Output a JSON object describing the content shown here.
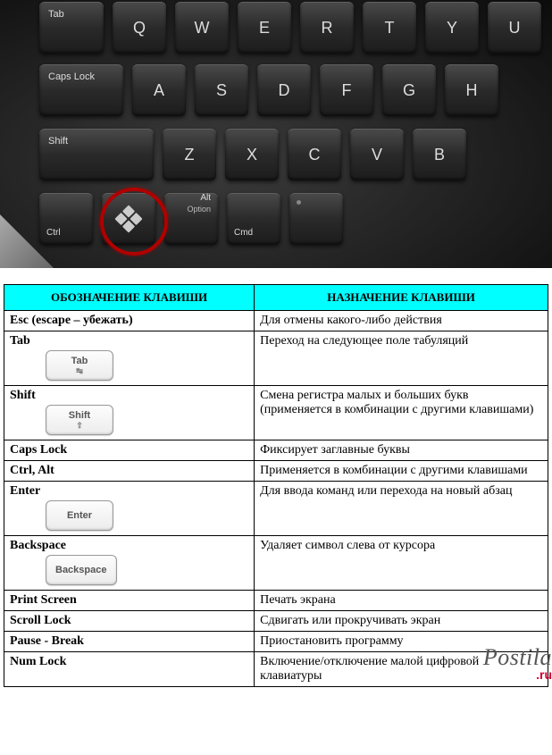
{
  "keyboard": {
    "row0": [
      "Tab",
      "Q",
      "W",
      "E",
      "R",
      "T",
      "Y",
      "U"
    ],
    "row1": [
      "Caps Lock",
      "A",
      "S",
      "D",
      "F",
      "G",
      "H"
    ],
    "row2": [
      "Shift",
      "Z",
      "X",
      "C",
      "V",
      "B"
    ],
    "row3": {
      "ctrl": "Ctrl",
      "win": "windows-key",
      "alt": "Alt",
      "option": "Option",
      "cmd": "Cmd",
      "space": " "
    },
    "highlight": "windows-key"
  },
  "table": {
    "header_key": "ОБОЗНАЧЕНИЕ КЛАВИШИ",
    "header_desc": "НАЗНАЧЕНИЕ КЛАВИШИ",
    "rows": [
      {
        "key": "Esc (escape – убежать)",
        "desc": "Для отмены какого-либо действия",
        "cap": null
      },
      {
        "key": "Tab",
        "desc": "Переход на следующее поле табуляций",
        "cap": "Tab",
        "cap_sub": "↹"
      },
      {
        "key": "Shift",
        "desc": "Смена регистра малых и больших букв (применяется в комбинации с другими клавишами)",
        "cap": "Shift",
        "cap_sub": "⇧"
      },
      {
        "key": "Caps Lock",
        "desc": "Фиксирует заглавные буквы",
        "cap": null
      },
      {
        "key": "Ctrl, Alt",
        "desc": "Применяется в комбинации с другими клавишами",
        "cap": null
      },
      {
        "key": "Enter",
        "desc": "Для ввода команд или перехода на новый абзац",
        "cap": "Enter",
        "cap_sub": null
      },
      {
        "key": "Backspace",
        "desc": "Удаляет символ слева от курсора",
        "cap": "Backspace",
        "cap_sub": null
      },
      {
        "key": "Print Screen",
        "desc": "Печать экрана",
        "cap": null
      },
      {
        "key": "Scroll Lock",
        "desc": "Сдвигать или прокручивать экран",
        "cap": null
      },
      {
        "key": "Pause - Break",
        "desc": "Приостановить программу",
        "cap": null
      },
      {
        "key": "Num Lock",
        "desc": "Включение/отключение малой цифровой клавиатуры",
        "cap": null
      }
    ]
  },
  "watermark": {
    "brand": "Postila",
    "domain": ".ru"
  }
}
